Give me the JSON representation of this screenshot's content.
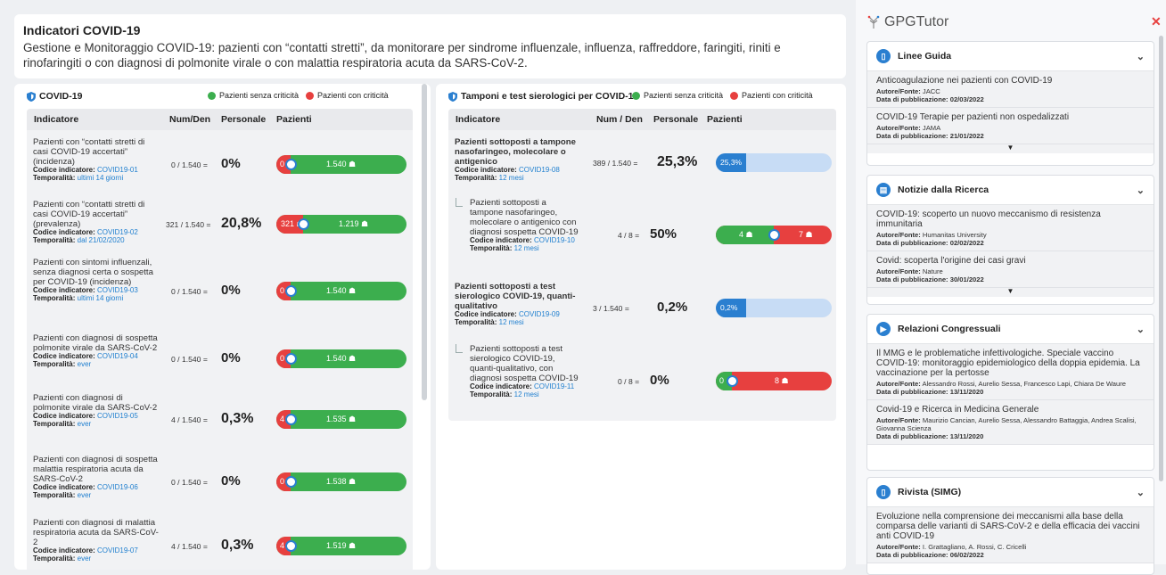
{
  "header": {
    "title": "Indicatori COVID-19",
    "description": "Gestione e Monitoraggio COVID-19: pazienti con “contatti stretti”, da monitorare per sindrome influenzale, influenza, raffreddore, faringiti, riniti e rinofaringiti o con diagnosi di polmonite virale o con malattia respiratoria acuta da SARS-CoV-2."
  },
  "legend": {
    "green": "Pazienti senza criticità",
    "red": "Pazienti con criticità"
  },
  "colors": {
    "green": "#3cae4e",
    "red": "#e7403f",
    "blue": "#2a7fd0",
    "light_blue": "#c7dcf5"
  },
  "panel1": {
    "title": "COVID-19",
    "columns": [
      "Indicatore",
      "Num/Den",
      "Personale",
      "Pazienti"
    ],
    "rows": [
      {
        "name": "Pazienti con “contatti stretti di casi COVID-19 accertati” (incidenza)",
        "code_label": "Codice indicatore:",
        "code": "COVID19-01",
        "temp_label": "Temporalità:",
        "temp": "ultimi 14 giorni",
        "numden": "0 / 1.540 =",
        "perc": "0%",
        "red_label": "0",
        "green_label": "1.540",
        "red_share": 0
      },
      {
        "name": "Pazienti con “contatti stretti di casi COVID-19 accertati” (prevalenza)",
        "code_label": "Codice indicatore:",
        "code": "COVID19-02",
        "temp_label": "Temporalità:",
        "temp": "dal 21/02/2020",
        "numden": "321 / 1.540 =",
        "perc": "20,8%",
        "red_label": "321",
        "green_label": "1.219",
        "red_share": 0.208
      },
      {
        "name": "Pazienti con sintomi influenzali, senza diagnosi certa o sospetta per COVID-19 (incidenza)",
        "code_label": "Codice indicatore:",
        "code": "COVID19-03",
        "temp_label": "Temporalità:",
        "temp": "ultimi 14 giorni",
        "numden": "0 / 1.540 =",
        "perc": "0%",
        "red_label": "0",
        "green_label": "1.540",
        "red_share": 0
      },
      {
        "name": "Pazienti con diagnosi di sospetta polmonite virale da SARS-CoV-2",
        "code_label": "Codice indicatore:",
        "code": "COVID19-04",
        "temp_label": "Temporalità:",
        "temp": "ever",
        "numden": "0 / 1.540 =",
        "perc": "0%",
        "red_label": "0",
        "green_label": "1.540",
        "red_share": 0
      },
      {
        "name": "Pazienti con diagnosi di polmonite virale da SARS-CoV-2",
        "code_label": "Codice indicatore:",
        "code": "COVID19-05",
        "temp_label": "Temporalità:",
        "temp": "ever",
        "numden": "4 / 1.540 =",
        "perc": "0,3%",
        "red_label": "4",
        "green_label": "1.535",
        "red_share": 0.003
      },
      {
        "name": "Pazienti con diagnosi di sospetta malattia respiratoria acuta da SARS-CoV-2",
        "code_label": "Codice indicatore:",
        "code": "COVID19-06",
        "temp_label": "Temporalità:",
        "temp": "ever",
        "numden": "0 / 1.540 =",
        "perc": "0%",
        "red_label": "0",
        "green_label": "1.538",
        "red_share": 0
      },
      {
        "name": "Pazienti con diagnosi di malattia respiratoria acuta da SARS-CoV-2",
        "code_label": "Codice indicatore:",
        "code": "COVID19-07",
        "temp_label": "Temporalità:",
        "temp": "ever",
        "numden": "4 / 1.540 =",
        "perc": "0,3%",
        "red_label": "4",
        "green_label": "1.519",
        "red_share": 0.003
      }
    ]
  },
  "panel2": {
    "title": "Tamponi e test sierologici per COVID-19",
    "columns": [
      "Indicatore",
      "Num / Den",
      "Personale",
      "Pazienti"
    ],
    "rows": [
      {
        "name": "Pazienti sottoposti a tampone nasofaringeo, molecolare o antigenico",
        "code_label": "Codice indicatore:",
        "code": "COVID19-08",
        "temp_label": "Temporalità:",
        "temp": "12 mesi",
        "numden": "389 / 1.540 =",
        "perc": "25,3%",
        "bar_label": "25,3%",
        "share": 0.253
      },
      {
        "name": "Pazienti sottoposti a tampone nasofaringeo, molecolare o antigenico con diagnosi sospetta COVID-19",
        "code_label": "Codice indicatore:",
        "code": "COVID19-10",
        "temp_label": "Temporalità:",
        "temp": "12 mesi",
        "numden": "4 / 8 =",
        "perc": "50%",
        "green_label": "4",
        "red_label": "7",
        "red_share": 0.5
      },
      {
        "name": "Pazienti sottoposti a test sierologico COVID-19, quanti-qualitativo",
        "code_label": "Codice indicatore:",
        "code": "COVID19-09",
        "temp_label": "Temporalità:",
        "temp": "12 mesi",
        "numden": "3 / 1.540 =",
        "perc": "0,2%",
        "bar_label": "0,2%",
        "share": 0.002
      },
      {
        "name": "Pazienti sottoposti a test sierologico COVID-19, quanti-qualitativo, con diagnosi sospetta COVID-19",
        "code_label": "Codice indicatore:",
        "code": "COVID19-11",
        "temp_label": "Temporalità:",
        "temp": "12 mesi",
        "numden": "0 / 8 =",
        "perc": "0%",
        "green_label": "0",
        "red_label": "8",
        "red_share": 1
      }
    ]
  },
  "sidebar": {
    "brand": "GPGTutor",
    "sections": [
      {
        "title": "Linee Guida",
        "icon": "document-icon",
        "items": [
          {
            "title": "Anticoagulazione nei pazienti con COVID-19",
            "author_label": "Autore/Fonte:",
            "author": "JACC",
            "date_label": "Data di pubblicazione:",
            "date": "02/03/2022"
          },
          {
            "title": "COVID-19 Terapie per pazienti non ospedalizzati",
            "author_label": "Autore/Fonte:",
            "author": "JAMA",
            "date_label": "Data di pubblicazione:",
            "date": "21/01/2022"
          }
        ]
      },
      {
        "title": "Notizie dalla Ricerca",
        "icon": "news-icon",
        "items": [
          {
            "title": "COVID-19: scoperto un nuovo meccanismo di resistenza immunitaria",
            "author_label": "Autore/Fonte:",
            "author": "Humanitas University",
            "date_label": "Data di pubblicazione:",
            "date": "02/02/2022"
          },
          {
            "title": "Covid: scoperta l'origine dei casi gravi",
            "author_label": "Autore/Fonte:",
            "author": "Nature",
            "date_label": "Data di pubblicazione:",
            "date": "30/01/2022"
          }
        ]
      },
      {
        "title": "Relazioni Congressuali",
        "icon": "video-icon",
        "items": [
          {
            "title": "Il MMG e le problematiche infettivologiche. Speciale vaccino COVID-19: monitoraggio epidemiologico della doppia epidemia. La vaccinazione per la pertosse",
            "author_label": "Autore/Fonte:",
            "author": "Alessandro Rossi, Aurelio Sessa, Francesco Lapi, Chiara De Waure",
            "date_label": "Data di pubblicazione:",
            "date": "13/11/2020"
          },
          {
            "title": "Covid-19 e Ricerca in Medicina Generale",
            "author_label": "Autore/Fonte:",
            "author": "Maurizio Cancian, Aurelio Sessa, Alessandro Battaggia, Andrea Scalisi, Giovanna Scienza",
            "date_label": "Data di pubblicazione:",
            "date": "13/11/2020"
          }
        ]
      },
      {
        "title": "Rivista (SIMG)",
        "icon": "document-icon",
        "items": [
          {
            "title": "Evoluzione nella comprensione dei meccanismi alla base della comparsa delle varianti di SARS-CoV-2 e della efficacia dei vaccini anti COVID-19",
            "author_label": "Autore/Fonte:",
            "author": "I. Grattagliano, A. Rossi, C. Cricelli",
            "date_label": "Data di pubblicazione:",
            "date": "06/02/2022"
          }
        ]
      }
    ]
  }
}
